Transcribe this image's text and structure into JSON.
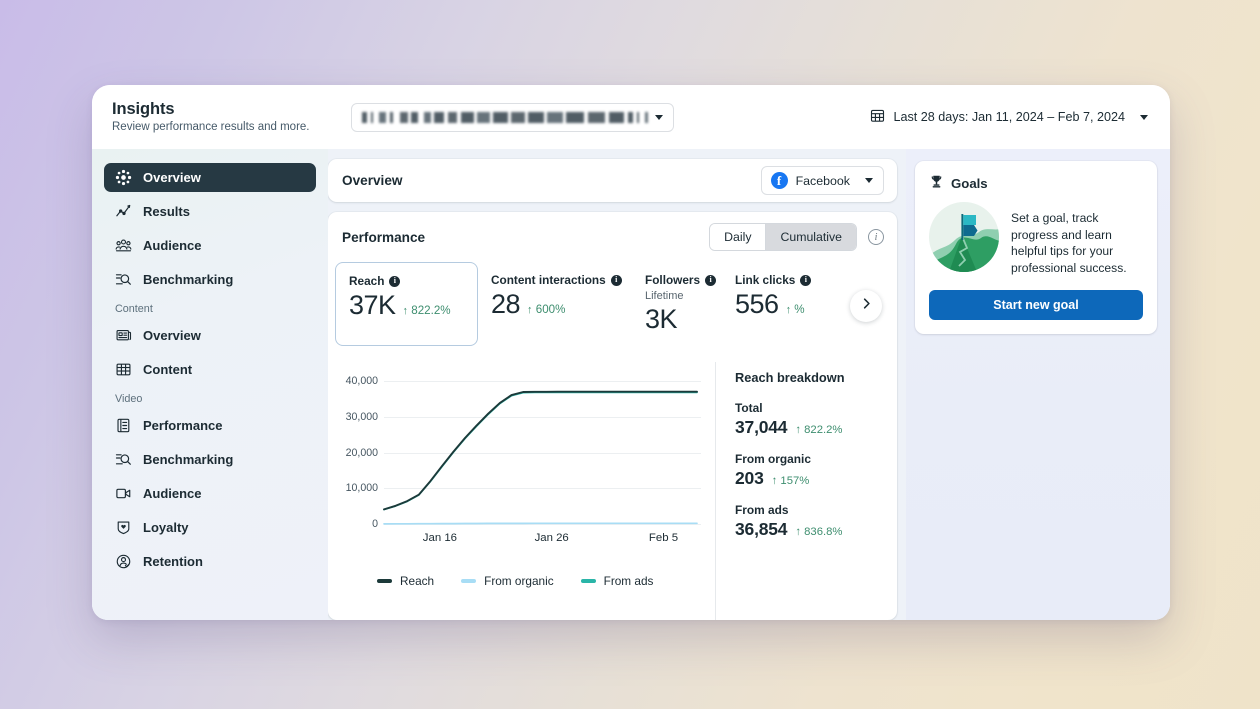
{
  "header": {
    "title": "Insights",
    "subtitle": "Review performance results and more.",
    "account_selector_placeholder": "",
    "date_range": "Last 28 days: Jan 11, 2024 – Feb 7, 2024"
  },
  "sidebar": {
    "items": [
      {
        "label": "Overview",
        "icon": "hub-icon",
        "active": true
      },
      {
        "label": "Results",
        "icon": "line-chart-icon",
        "active": false
      },
      {
        "label": "Audience",
        "icon": "people-icon",
        "active": false
      },
      {
        "label": "Benchmarking",
        "icon": "search-list-icon",
        "active": false
      }
    ],
    "groups": [
      {
        "label": "Content",
        "items": [
          {
            "label": "Overview",
            "icon": "news-icon"
          },
          {
            "label": "Content",
            "icon": "table-icon"
          }
        ]
      },
      {
        "label": "Video",
        "items": [
          {
            "label": "Performance",
            "icon": "list-doc-icon"
          },
          {
            "label": "Benchmarking",
            "icon": "search-list-icon"
          },
          {
            "label": "Audience",
            "icon": "video-camera-icon"
          },
          {
            "label": "Loyalty",
            "icon": "shield-heart-icon"
          },
          {
            "label": "Retention",
            "icon": "user-check-icon"
          }
        ]
      }
    ]
  },
  "overview_card": {
    "title": "Overview",
    "platform": "Facebook"
  },
  "performance": {
    "title": "Performance",
    "toggle": {
      "options": [
        "Daily",
        "Cumulative"
      ],
      "selected": "Cumulative"
    },
    "info_tooltip": "i",
    "metrics": [
      {
        "label": "Reach",
        "sublabel": "",
        "value": "37K",
        "delta": "822.2%",
        "direction": "up",
        "selected": true
      },
      {
        "label": "Content interactions",
        "sublabel": "",
        "value": "28",
        "delta": "600%",
        "direction": "up",
        "selected": false
      },
      {
        "label": "Followers",
        "sublabel": "Lifetime",
        "value": "3K",
        "delta": "",
        "direction": "",
        "selected": false
      },
      {
        "label": "Link clicks",
        "sublabel": "",
        "value": "556",
        "delta": "%",
        "direction": "up",
        "selected": false
      }
    ],
    "next_arrow": "chevron-right"
  },
  "breakdown": {
    "title": "Reach breakdown",
    "rows": [
      {
        "label": "Total",
        "value": "37,044",
        "delta": "822.2%",
        "direction": "up"
      },
      {
        "label": "From organic",
        "value": "203",
        "delta": "157%",
        "direction": "up"
      },
      {
        "label": "From ads",
        "value": "36,854",
        "delta": "836.8%",
        "direction": "up"
      }
    ]
  },
  "goals": {
    "title": "Goals",
    "description": "Set a goal, track progress and learn helpful tips for your professional success.",
    "button": "Start new goal"
  },
  "colors": {
    "reach": "#1c3a3a",
    "from_organic": "#a8ddf5",
    "from_ads": "#2ab5a8",
    "accent_blue": "#0d68ba",
    "positive": "#3e8e6f",
    "sidebar_active_bg": "#263943"
  },
  "chart_data": {
    "type": "line",
    "title": "",
    "xlabel": "",
    "ylabel": "",
    "ylim": [
      0,
      42000
    ],
    "yticks": [
      0,
      10000,
      20000,
      30000,
      40000
    ],
    "ytick_labels": [
      "0",
      "10,000",
      "20,000",
      "30,000",
      "40,000"
    ],
    "xtick_labels": [
      "Jan 16",
      "Jan 26",
      "Feb 5"
    ],
    "xtick_positions": [
      0.1786,
      0.5357,
      0.8929
    ],
    "grid": true,
    "legend_position": "bottom-left",
    "x": [
      "Jan 11",
      "Jan 12",
      "Jan 13",
      "Jan 14",
      "Jan 15",
      "Jan 16",
      "Jan 17",
      "Jan 18",
      "Jan 19",
      "Jan 20",
      "Jan 21",
      "Jan 22",
      "Jan 23",
      "Jan 24",
      "Jan 25",
      "Jan 26",
      "Jan 27",
      "Jan 28",
      "Jan 29",
      "Jan 30",
      "Jan 31",
      "Feb 1",
      "Feb 2",
      "Feb 3",
      "Feb 4",
      "Feb 5",
      "Feb 6",
      "Feb 7"
    ],
    "series": [
      {
        "name": "Reach",
        "color": "#1c3a3a",
        "values": [
          4100,
          5100,
          6400,
          8200,
          12000,
          16200,
          20300,
          24100,
          27600,
          30900,
          33900,
          36100,
          36950,
          37020,
          37030,
          37035,
          37038,
          37040,
          37041,
          37042,
          37042,
          37043,
          37043,
          37044,
          37044,
          37044,
          37044,
          37044
        ]
      },
      {
        "name": "From ads",
        "color": "#2ab5a8",
        "values": [
          4050,
          5040,
          6330,
          8120,
          11900,
          16080,
          20170,
          23960,
          27450,
          30740,
          33730,
          35930,
          36770,
          36840,
          36848,
          36850,
          36851,
          36852,
          36852,
          36853,
          36853,
          36853,
          36854,
          36854,
          36854,
          36854,
          36854,
          36854
        ]
      },
      {
        "name": "From organic",
        "color": "#a8ddf5",
        "values": [
          30,
          48,
          62,
          75,
          92,
          108,
          122,
          134,
          146,
          155,
          163,
          170,
          178,
          183,
          188,
          191,
          194,
          196,
          198,
          199,
          200,
          201,
          201,
          202,
          202,
          203,
          203,
          203
        ]
      }
    ]
  }
}
